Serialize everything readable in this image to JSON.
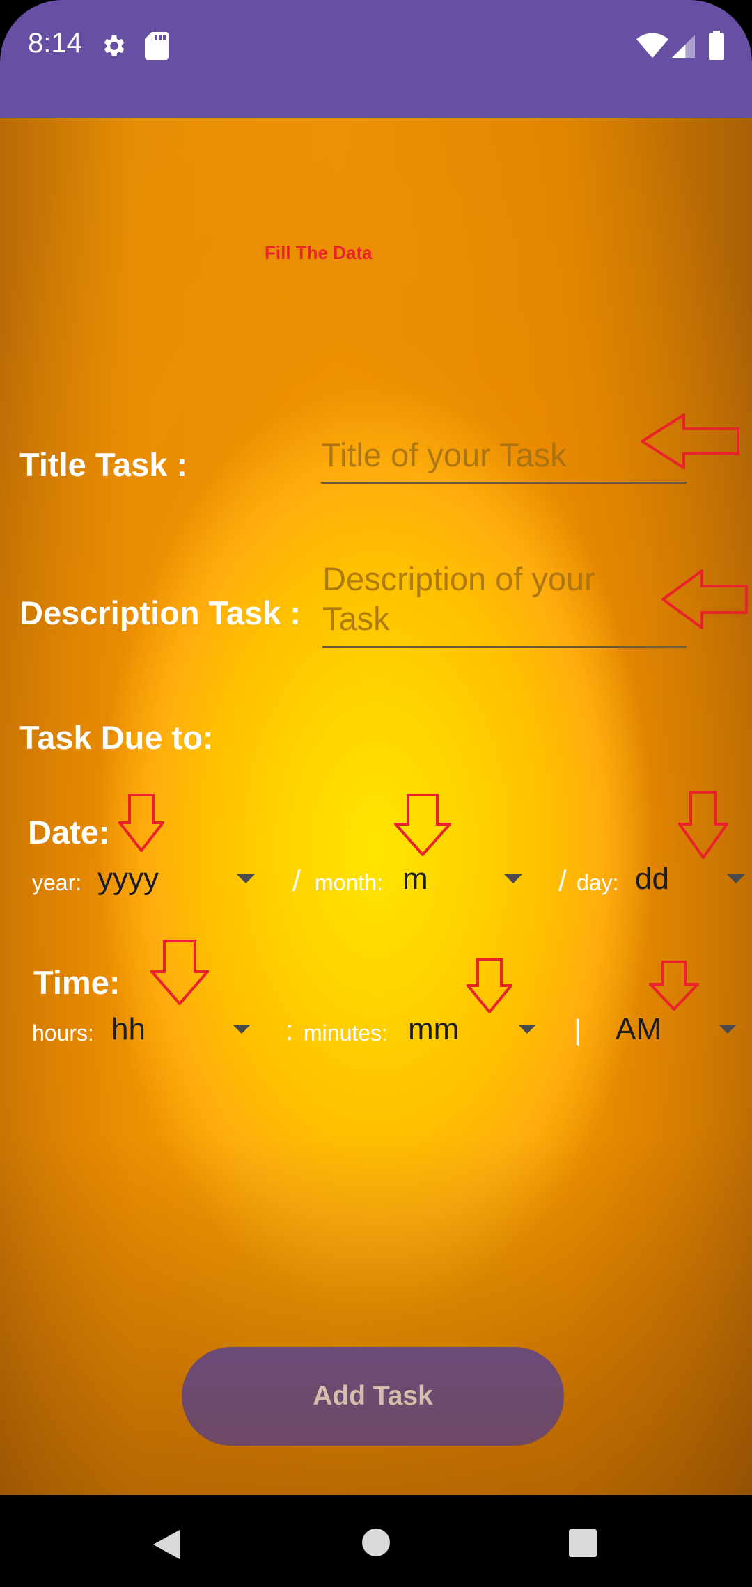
{
  "status_bar": {
    "time": "8:14",
    "icons": [
      "gear-icon",
      "sd-card-icon",
      "wifi-icon",
      "cell-signal-icon",
      "battery-icon"
    ]
  },
  "header": {
    "title": "Fill The Data"
  },
  "form": {
    "title_label": "Title Task :",
    "title_placeholder": "Title of your Task",
    "description_label": "Description Task :",
    "description_placeholder_line1": "Description of your",
    "description_placeholder_line2": "Task",
    "due_label": "Task Due to:",
    "date_label": "Date:",
    "year_label": "year:",
    "year_value": "yyyy",
    "date_sep1": "/",
    "month_label": "month:",
    "month_value": "m",
    "date_sep2": "/",
    "day_label": "day:",
    "day_value": "dd",
    "time_label": "Time:",
    "hours_label": "hours:",
    "hours_value": "hh",
    "time_sep1": ":",
    "minutes_label": "minutes:",
    "minutes_value": "mm",
    "time_sep2": "|",
    "ampm_value": "AM"
  },
  "actions": {
    "add_label": "Add Task"
  },
  "colors": {
    "accent": "#6750A4",
    "annotation_arrow": "#e8232a",
    "title_text": "#e8232a"
  },
  "nav": {
    "icons": [
      "back-icon",
      "home-icon",
      "recents-icon"
    ]
  }
}
